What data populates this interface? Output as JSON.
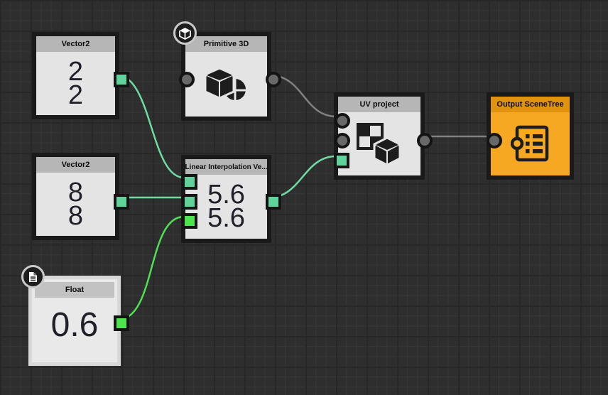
{
  "nodes": [
    {
      "id": "vector2-a",
      "title": "Vector2",
      "values": [
        "2",
        "2"
      ]
    },
    {
      "id": "primitive-3d",
      "title": "Primitive 3D",
      "icon": "primitive-3d-icon",
      "badge": "cube-badge-icon"
    },
    {
      "id": "vector2-b",
      "title": "Vector2",
      "values": [
        "8",
        "8"
      ]
    },
    {
      "id": "lerp",
      "title": "Linear Interpolation Ve...",
      "values": [
        "5.6",
        "5.6"
      ]
    },
    {
      "id": "float",
      "title": "Float",
      "values": [
        "0.6"
      ],
      "badge": "document-badge-icon",
      "selected": true
    },
    {
      "id": "uv-project",
      "title": "UV project",
      "icon": "uv-project-icon"
    },
    {
      "id": "output-scenetree",
      "title": "Output SceneTree",
      "icon": "scene-tree-icon"
    }
  ],
  "connections": [
    {
      "from": "vector2-a.out",
      "to": "lerp.in1",
      "color": "green"
    },
    {
      "from": "vector2-b.out",
      "to": "lerp.in2",
      "color": "green"
    },
    {
      "from": "float.out",
      "to": "lerp.in3",
      "color": "lime"
    },
    {
      "from": "lerp.out",
      "to": "uv-project.in3",
      "color": "green"
    },
    {
      "from": "primitive-3d.out",
      "to": "uv-project.in1",
      "color": "gray"
    },
    {
      "from": "uv-project.out",
      "to": "output-scenetree.in1",
      "color": "gray"
    }
  ],
  "colors": {
    "canvas_bg": "#2e2e2e",
    "grid_minor": "#383838",
    "grid_major": "#272727",
    "node_border": "#1a1a1a",
    "node_body": "#e4e4e4",
    "node_header": "#b6b6b6",
    "header_text": "#0d0d0d",
    "value_text": "#20202a",
    "orange_body": "#f7a823",
    "orange_header": "#e0930f",
    "port_green": "#5fd39a",
    "port_lime": "#4fe351",
    "port_gray": "#686868",
    "wire_green": "#6edca2",
    "wire_lime": "#4fdf55",
    "wire_gray": "#808080",
    "selected_border": "#d8d8d8"
  }
}
